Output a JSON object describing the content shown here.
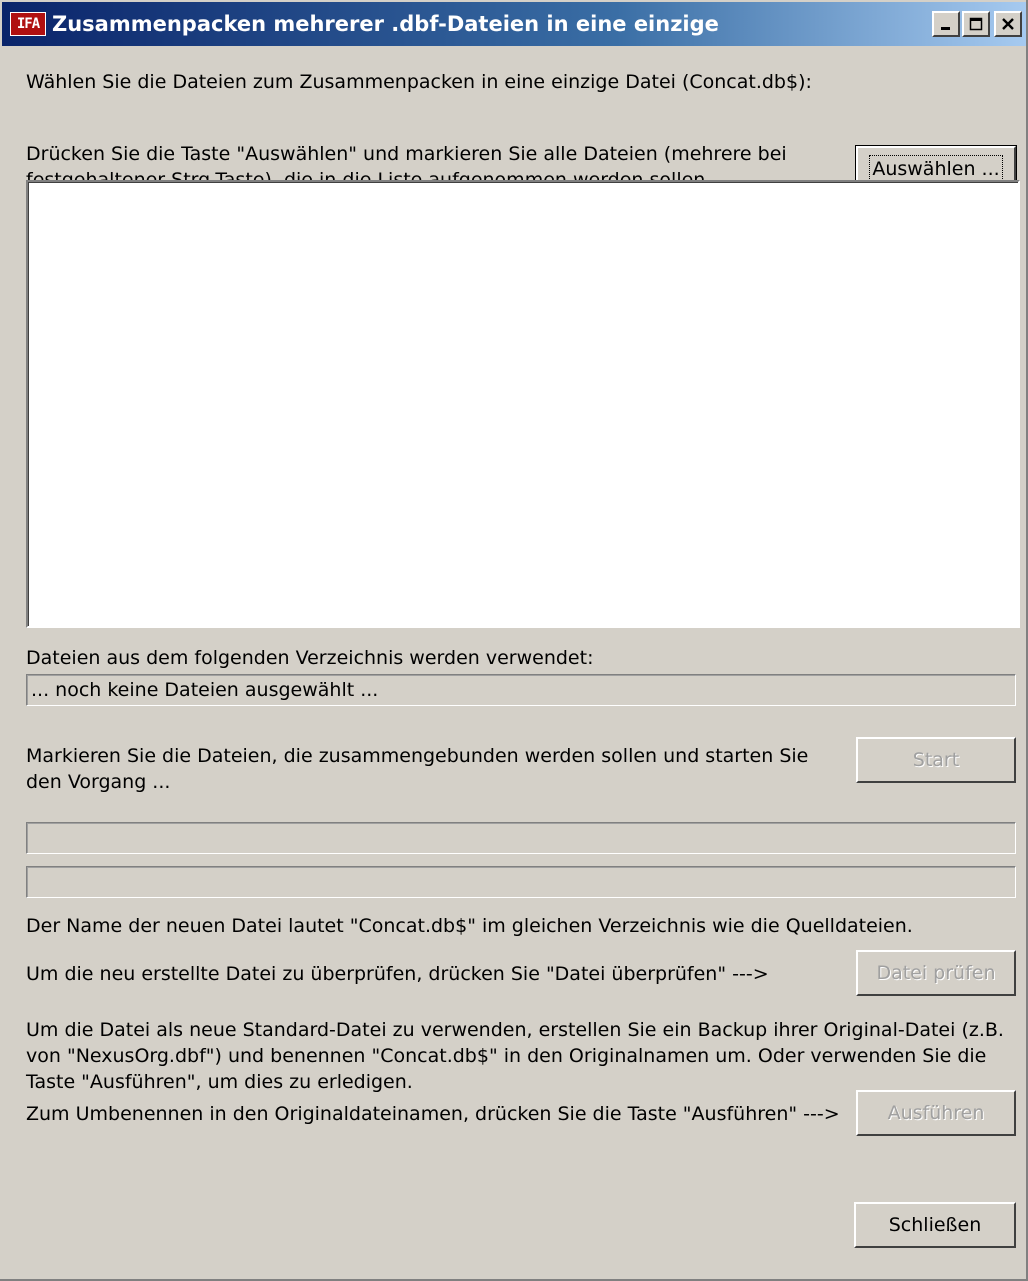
{
  "window": {
    "title": "Zusammenpacken mehrerer .dbf-Dateien in eine einzige",
    "icon_text": "IFA"
  },
  "intro": {
    "line1": "Wählen Sie die Dateien zum Zusammenpacken in eine einzige Datei (Concat.db$):",
    "select_line1": "Drücken Sie die Taste \"Auswählen\" und markieren Sie alle Dateien (mehrere bei",
    "select_line2": "festgehaltener Strg-Taste), die in die Liste aufgenommen werden sollen."
  },
  "buttons": {
    "select": "Auswählen ...",
    "start": "Start",
    "check": "Datei prüfen",
    "execute": "Ausführen",
    "close": "Schließen"
  },
  "file_list": {
    "items": []
  },
  "directory": {
    "label": "Dateien aus dem folgenden Verzeichnis werden verwendet:",
    "value": "... noch keine Dateien ausgewählt ..."
  },
  "start_section": {
    "line1": "Markieren Sie die Dateien, die zusammengebunden werden sollen und starten Sie",
    "line2": "den Vorgang ..."
  },
  "progress": {
    "bar1_fraction": 0,
    "bar2_fraction": 0
  },
  "info": {
    "new_file_name": "Der Name der neuen Datei lautet \"Concat.db$\" im gleichen Verzeichnis wie die Quelldateien.",
    "check_instruction": "Um die neu erstellte Datei zu überprüfen, drücken Sie \"Datei überprüfen\" --->",
    "backup_line1": "Um die Datei als neue Standard-Datei zu verwenden, erstellen Sie ein Backup ihrer Original-Datei (z.B.",
    "backup_line2": "von \"NexusOrg.dbf\") und benennen \"Concat.db$\" in den Originalnamen um. Oder verwenden Sie die",
    "backup_line3": "Taste \"Ausführen\", um dies zu erledigen.",
    "rename_instruction": "Zum Umbenennen in den Originaldateinamen, drücken Sie die Taste \"Ausführen\" --->"
  }
}
